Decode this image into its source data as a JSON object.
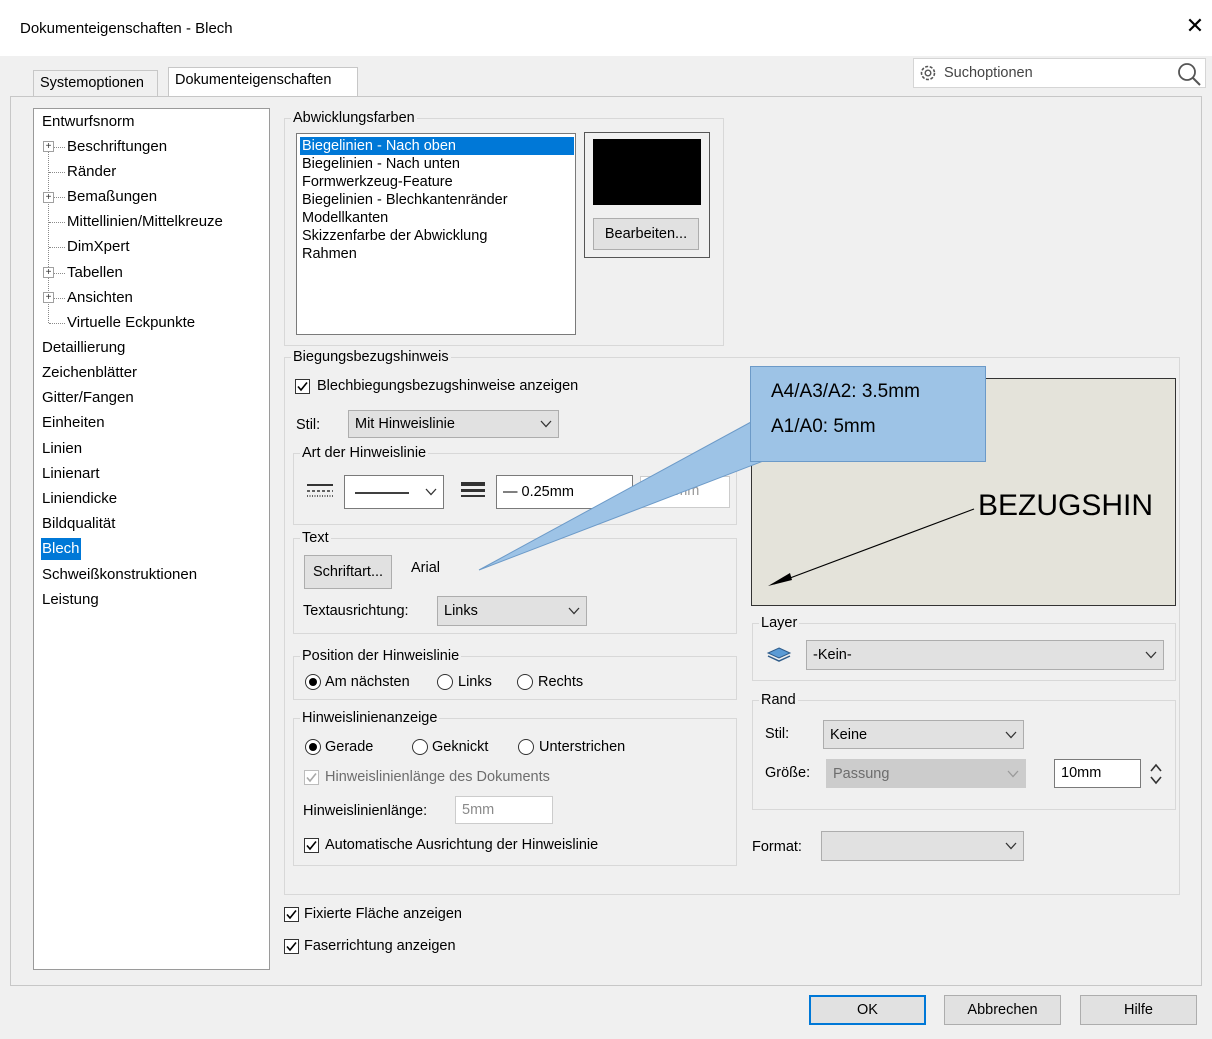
{
  "window": {
    "title": "Dokumenteigenschaften - Blech"
  },
  "tabs": [
    "Systemoptionen",
    "Dokumenteigenschaften"
  ],
  "search": {
    "placeholder": "Suchoptionen"
  },
  "tree": {
    "items": [
      "Entwurfsnorm",
      "Beschriftungen",
      "Ränder",
      "Bemaßungen",
      "Mittellinien/Mittelkreuze",
      "DimXpert",
      "Tabellen",
      "Ansichten",
      "Virtuelle Eckpunkte",
      "Detaillierung",
      "Zeichenblätter",
      "Gitter/Fangen",
      "Einheiten",
      "Linien",
      "Linienart",
      "Liniendicke",
      "Bildqualität",
      "Blech",
      "Schweißkonstruktionen",
      "Leistung"
    ],
    "selected": "Blech"
  },
  "colors_group": {
    "title": "Abwicklungsfarben",
    "items": [
      "Biegelinien - Nach oben",
      "Biegelinien - Nach unten",
      "Formwerkzeug-Feature",
      "Biegelinien - Blechkantenränder",
      "Modellkanten",
      "Skizzenfarbe der Abwicklung",
      "Rahmen"
    ],
    "selected": "Biegelinien - Nach oben",
    "swatch_color": "#000000",
    "edit_button": "Bearbeiten..."
  },
  "bend": {
    "title": "Biegungsbezugshinweis",
    "show_label": "Blechbiegungsbezugshinweise anzeigen",
    "style_label": "Stil:",
    "style_value": "Mit Hinweislinie",
    "line_type_title": "Art der Hinweislinie",
    "line_thickness": "— 0.25mm",
    "line_custom": "0.18mm",
    "text_title": "Text",
    "font_button": "Schriftart...",
    "font_name": "Arial",
    "align_label": "Textausrichtung:",
    "align_value": "Links",
    "pos_title": "Position der Hinweislinie",
    "pos_options": [
      "Am nächsten",
      "Links",
      "Rechts"
    ],
    "pos_selected": "Am nächsten",
    "display_title": "Hinweislinienanzeige",
    "display_options": [
      "Gerade",
      "Geknickt",
      "Unterstrichen"
    ],
    "display_selected": "Gerade",
    "doc_length_label": "Hinweislinienlänge des Dokuments",
    "length_label": "Hinweislinienlänge:",
    "length_value": "5mm",
    "auto_align_label": "Automatische Ausrichtung der Hinweislinie"
  },
  "preview": {
    "text": "BEZUGSHIN"
  },
  "layer": {
    "title": "Layer",
    "value": "-Kein-"
  },
  "border": {
    "title": "Rand",
    "style_label": "Stil:",
    "style_value": "Keine",
    "size_label": "Größe:",
    "size_value": "Passung",
    "size_num": "10mm"
  },
  "format": {
    "label": "Format:",
    "value": ""
  },
  "bottom": {
    "fixed_face": "Fixierte Fläche anzeigen",
    "grain_dir": "Faserrichtung anzeigen"
  },
  "buttons": {
    "ok": "OK",
    "cancel": "Abbrechen",
    "help": "Hilfe"
  },
  "callout": {
    "line1": "A4/A3/A2: 3.5mm",
    "line2": "A1/A0: 5mm"
  }
}
